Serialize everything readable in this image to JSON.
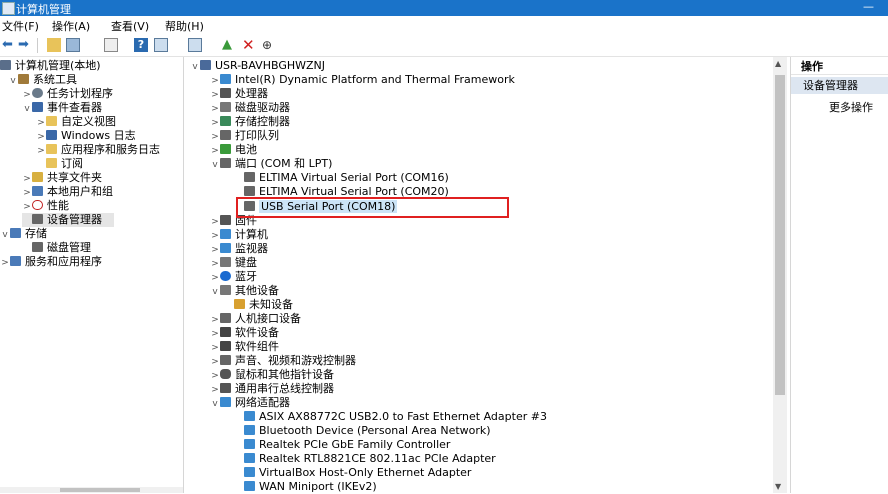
{
  "window": {
    "title": "计算机管理"
  },
  "menu": [
    "文件(F)",
    "操作(A)",
    "查看(V)",
    "帮助(H)"
  ],
  "left_tree": [
    {
      "label": "计算机管理(本地)",
      "icon": "computer-management-icon",
      "color": "#5a6e8a",
      "expander": ""
    },
    {
      "label": "系统工具",
      "icon": "tools-icon",
      "color": "#a07a3a",
      "expander": "v"
    },
    {
      "label": "任务计划程序",
      "icon": "clock-icon",
      "color": "#6a7a8a",
      "expander": ">"
    },
    {
      "label": "事件查看器",
      "icon": "event-viewer-icon",
      "color": "#3a68a8",
      "expander": "v"
    },
    {
      "label": "自定义视图",
      "icon": "folder-icon",
      "color": "#e8c35a",
      "expander": ">"
    },
    {
      "label": "Windows 日志",
      "icon": "log-icon",
      "color": "#3a68a8",
      "expander": ">"
    },
    {
      "label": "应用程序和服务日志",
      "icon": "folder-icon",
      "color": "#e8c35a",
      "expander": ">"
    },
    {
      "label": "订阅",
      "icon": "subscription-icon",
      "color": "#e8c35a",
      "expander": ""
    },
    {
      "label": "共享文件夹",
      "icon": "shared-folder-icon",
      "color": "#d8b040",
      "expander": ">"
    },
    {
      "label": "本地用户和组",
      "icon": "users-icon",
      "color": "#4a7ab8",
      "expander": ">"
    },
    {
      "label": "性能",
      "icon": "performance-icon",
      "color": "#c02020",
      "expander": ">"
    },
    {
      "label": "设备管理器",
      "icon": "device-manager-icon",
      "color": "#666666",
      "expander": ""
    },
    {
      "label": "存储",
      "icon": "storage-icon",
      "color": "#4a7ab8",
      "expander": "v"
    },
    {
      "label": "磁盘管理",
      "icon": "disk-icon",
      "color": "#666666",
      "expander": ""
    },
    {
      "label": "服务和应用程序",
      "icon": "services-icon",
      "color": "#4a7ab8",
      "expander": ">"
    }
  ],
  "device_tree": [
    {
      "label": "USR-BAVHBGHWZNJ",
      "icon": "computer-icon",
      "color": "#4a6a9a",
      "expander": "v"
    },
    {
      "label": "Intel(R) Dynamic Platform and Thermal Framework",
      "icon": "device-folder-icon",
      "color": "#3a8ad0",
      "expander": ">"
    },
    {
      "label": "处理器",
      "icon": "processor-icon",
      "color": "#555555",
      "expander": ">"
    },
    {
      "label": "磁盘驱动器",
      "icon": "disk-drive-icon",
      "color": "#777777",
      "expander": ">"
    },
    {
      "label": "存储控制器",
      "icon": "storage-controller-icon",
      "color": "#3a8a5a",
      "expander": ">"
    },
    {
      "label": "打印队列",
      "icon": "printer-icon",
      "color": "#666666",
      "expander": ">"
    },
    {
      "label": "电池",
      "icon": "battery-icon",
      "color": "#3a9a3a",
      "expander": ">"
    },
    {
      "label": "端口 (COM 和 LPT)",
      "icon": "port-icon",
      "color": "#666666",
      "expander": "v"
    },
    {
      "label": "ELTIMA Virtual Serial Port (COM16)",
      "icon": "port-icon",
      "color": "#666666",
      "expander": ""
    },
    {
      "label": "ELTIMA Virtual Serial Port (COM20)",
      "icon": "port-icon",
      "color": "#666666",
      "expander": ""
    },
    {
      "label": "USB Serial Port (COM18)",
      "icon": "port-icon",
      "color": "#666666",
      "expander": ""
    },
    {
      "label": "固件",
      "icon": "firmware-icon",
      "color": "#555555",
      "expander": ">"
    },
    {
      "label": "计算机",
      "icon": "computer-icon",
      "color": "#3a8ad0",
      "expander": ">"
    },
    {
      "label": "监视器",
      "icon": "monitor-icon",
      "color": "#3a8ad0",
      "expander": ">"
    },
    {
      "label": "键盘",
      "icon": "keyboard-icon",
      "color": "#777777",
      "expander": ">"
    },
    {
      "label": "蓝牙",
      "icon": "bluetooth-icon",
      "color": "#1a6ad0",
      "expander": ">"
    },
    {
      "label": "其他设备",
      "icon": "other-devices-icon",
      "color": "#777777",
      "expander": "v"
    },
    {
      "label": "未知设备",
      "icon": "unknown-device-icon",
      "color": "#d8a030",
      "expander": ""
    },
    {
      "label": "人机接口设备",
      "icon": "hid-icon",
      "color": "#666666",
      "expander": ">"
    },
    {
      "label": "软件设备",
      "icon": "software-device-icon",
      "color": "#444444",
      "expander": ">"
    },
    {
      "label": "软件组件",
      "icon": "software-component-icon",
      "color": "#444444",
      "expander": ">"
    },
    {
      "label": "声音、视频和游戏控制器",
      "icon": "sound-icon",
      "color": "#666666",
      "expander": ">"
    },
    {
      "label": "鼠标和其他指针设备",
      "icon": "mouse-icon",
      "color": "#555555",
      "expander": ">"
    },
    {
      "label": "通用串行总线控制器",
      "icon": "usb-icon",
      "color": "#555555",
      "expander": ">"
    },
    {
      "label": "网络适配器",
      "icon": "network-adapter-icon",
      "color": "#3a8ad0",
      "expander": "v"
    },
    {
      "label": "ASIX AX88772C USB2.0 to Fast Ethernet Adapter #3",
      "icon": "network-adapter-icon",
      "color": "#3a8ad0",
      "expander": ""
    },
    {
      "label": "Bluetooth Device (Personal Area Network)",
      "icon": "network-adapter-icon",
      "color": "#3a8ad0",
      "expander": ""
    },
    {
      "label": "Realtek PCIe GbE Family Controller",
      "icon": "network-adapter-icon",
      "color": "#3a8ad0",
      "expander": ""
    },
    {
      "label": "Realtek RTL8821CE 802.11ac PCIe Adapter",
      "icon": "network-adapter-icon",
      "color": "#3a8ad0",
      "expander": ""
    },
    {
      "label": "VirtualBox Host-Only Ethernet Adapter",
      "icon": "network-adapter-icon",
      "color": "#3a8ad0",
      "expander": ""
    },
    {
      "label": "WAN Miniport (IKEv2)",
      "icon": "network-adapter-icon",
      "color": "#3a8ad0",
      "expander": ""
    }
  ],
  "actions": {
    "header": "操作",
    "section": "设备管理器",
    "more": "更多操作"
  },
  "colors": {
    "titlebar": "#1a73c9",
    "selection": "#cce4f7",
    "highlight_box": "#e02020"
  }
}
